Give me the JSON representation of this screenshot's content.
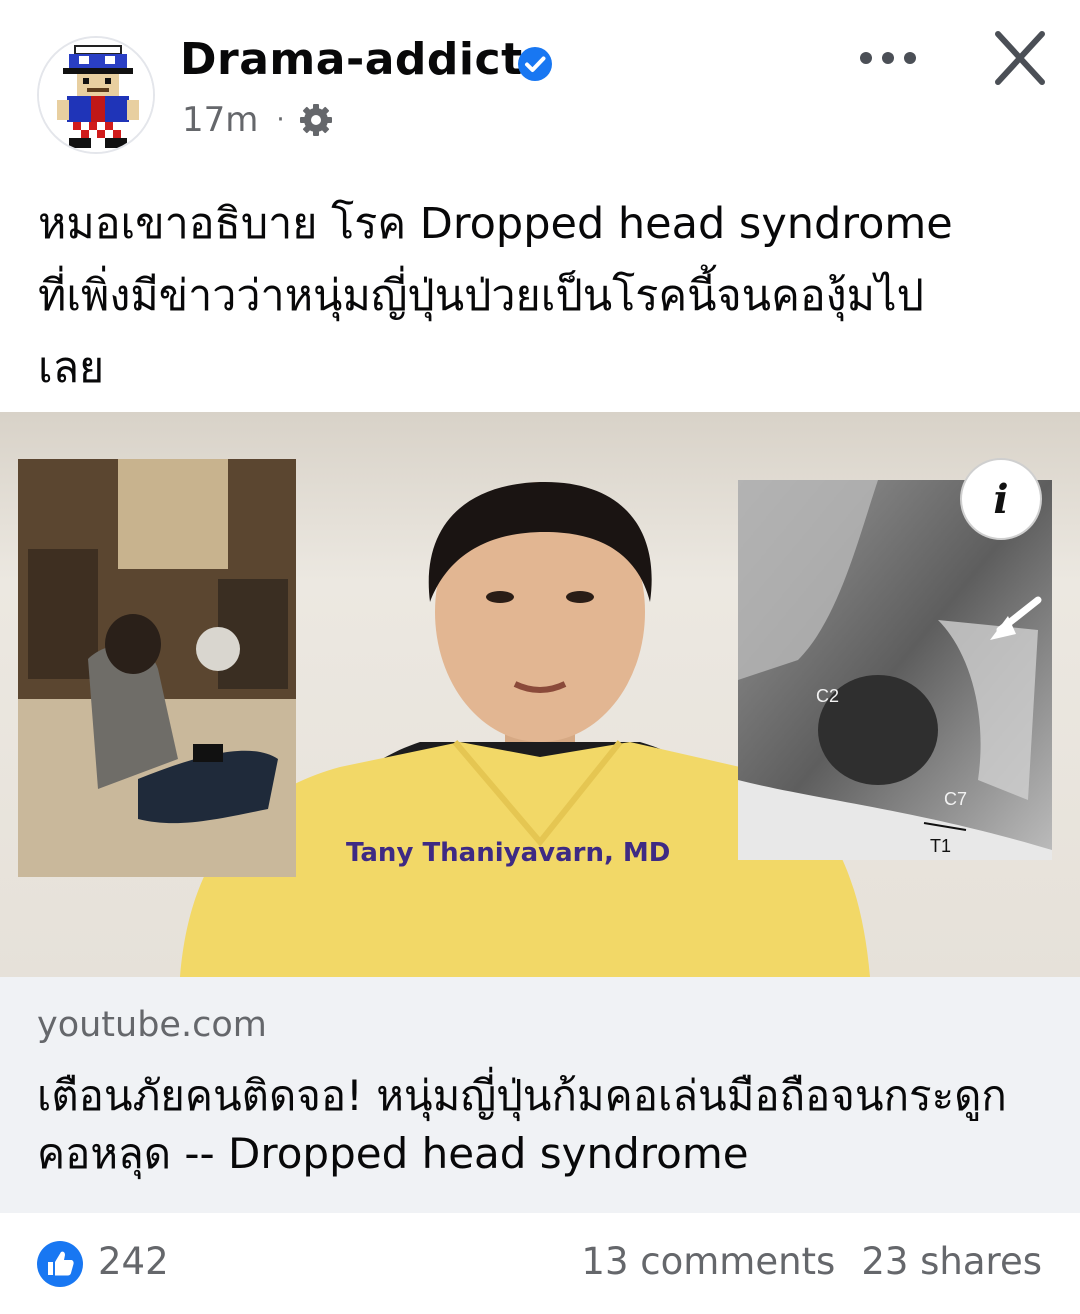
{
  "post": {
    "author": "Drama-addict",
    "time": "17m",
    "separator": "·",
    "text": "หมอเขาอธิบาย โรค Dropped head syndrome\nที่เพิ่งมีข่าวว่าหนุ่มญี่ปุ่นป่วยเป็นโรคนี้จนคองุ้มไป\nเลย"
  },
  "media": {
    "overlay_name": "Tany Thaniyavarn, MD",
    "xray_labels": {
      "c2": "C2",
      "c7": "C7",
      "t1": "T1"
    },
    "info_glyph": "i"
  },
  "link": {
    "domain": "youtube.com",
    "title": "เตือนภัยคนติดจอ! หนุ่มญี่ปุ่นก้มคอเล่นมือถือจนกระดูกคอหลุด -- Dropped head syndrome"
  },
  "footer": {
    "likes": "242",
    "comments": "13 comments",
    "shares": "23 shares"
  },
  "colors": {
    "accent": "#1877f2",
    "verified": "#1877f2",
    "link_bg": "#f0f2f5",
    "label_purple": "#3e2a84"
  },
  "icons": [
    "verified-badge-icon",
    "gear-icon",
    "more-icon",
    "close-icon",
    "info-icon",
    "like-icon"
  ]
}
